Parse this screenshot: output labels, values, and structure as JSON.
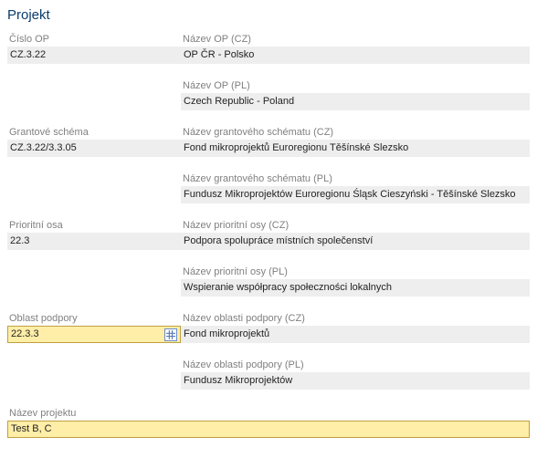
{
  "header": "Projekt",
  "fields": {
    "cisloOP": {
      "label": "Číslo OP",
      "value": "CZ.3.22"
    },
    "nazevOPCZ": {
      "label": "Název OP (CZ)",
      "value": "OP ČR - Polsko"
    },
    "nazevOPPL": {
      "label": "Název OP (PL)",
      "value": "Czech Republic - Poland"
    },
    "grantoveSchema": {
      "label": "Grantové schéma",
      "value": "CZ.3.22/3.3.05"
    },
    "nazevSchemaCZ": {
      "label": "Název grantového schématu (CZ)",
      "value": "Fond mikroprojektů Euroregionu Těšínské Slezsko"
    },
    "nazevSchemaPL": {
      "label": "Název grantového schématu (PL)",
      "value": "Fundusz Mikroprojektów Euroregionu Śląsk Cieszyński - Těšínské Slezsko"
    },
    "prioritniOsa": {
      "label": "Prioritní osa",
      "value": "22.3"
    },
    "nazevOsaCZ": {
      "label": "Název prioritní osy (CZ)",
      "value": "Podpora spolupráce místních společenství"
    },
    "nazevOsaPL": {
      "label": "Název prioritní osy (PL)",
      "value": "Wspieranie współpracy społeczności lokalnych"
    },
    "oblastPodpory": {
      "label": "Oblast podpory",
      "value": "22.3.3"
    },
    "nazevOblastCZ": {
      "label": "Název oblasti podpory (CZ)",
      "value": "Fond mikroprojektů"
    },
    "nazevOblastPL": {
      "label": "Název oblasti podpory (PL)",
      "value": "Fundusz Mikroprojektów"
    },
    "nazevProjektu": {
      "label": "Název projektu",
      "value": "Test B, C"
    }
  }
}
